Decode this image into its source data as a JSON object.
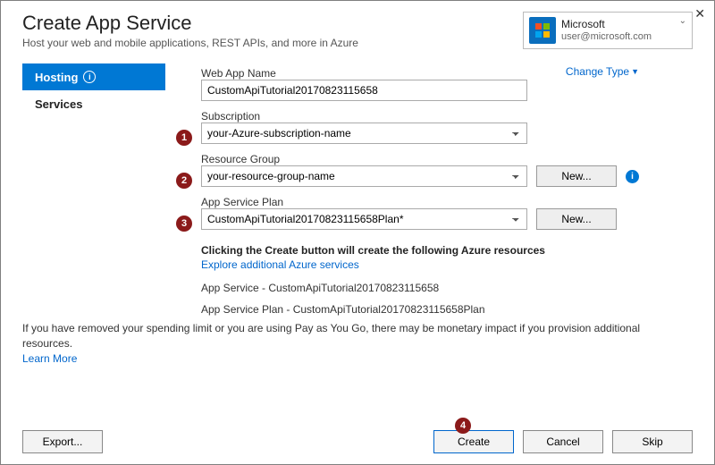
{
  "window": {
    "close": "✕"
  },
  "header": {
    "title": "Create App Service",
    "subtitle": "Host your web and mobile applications, REST APIs, and more in Azure"
  },
  "account": {
    "name": "Microsoft",
    "email": "user@microsoft.com"
  },
  "sidebar": {
    "hosting": "Hosting",
    "services": "Services"
  },
  "form": {
    "change_type": "Change Type",
    "web_app_name_label": "Web App Name",
    "web_app_name_value": "CustomApiTutorial20170823115658",
    "subscription_label": "Subscription",
    "subscription_value": "your-Azure-subscription-name",
    "resource_group_label": "Resource Group",
    "resource_group_value": "your-resource-group-name",
    "app_service_plan_label": "App Service Plan",
    "app_service_plan_value": "CustomApiTutorial20170823115658Plan*",
    "new_button": "New..."
  },
  "resources": {
    "heading": "Clicking the Create button will create the following Azure resources",
    "explore": "Explore additional Azure services",
    "line1": "App Service - CustomApiTutorial20170823115658",
    "line2": "App Service Plan - CustomApiTutorial20170823115658Plan"
  },
  "disclaimer": {
    "text": "If you have removed your spending limit or you are using Pay as You Go, there may be monetary impact if you provision additional resources.",
    "learn_more": "Learn More"
  },
  "footer": {
    "export": "Export...",
    "create": "Create",
    "cancel": "Cancel",
    "skip": "Skip"
  },
  "steps": {
    "s1": "1",
    "s2": "2",
    "s3": "3",
    "s4": "4"
  }
}
